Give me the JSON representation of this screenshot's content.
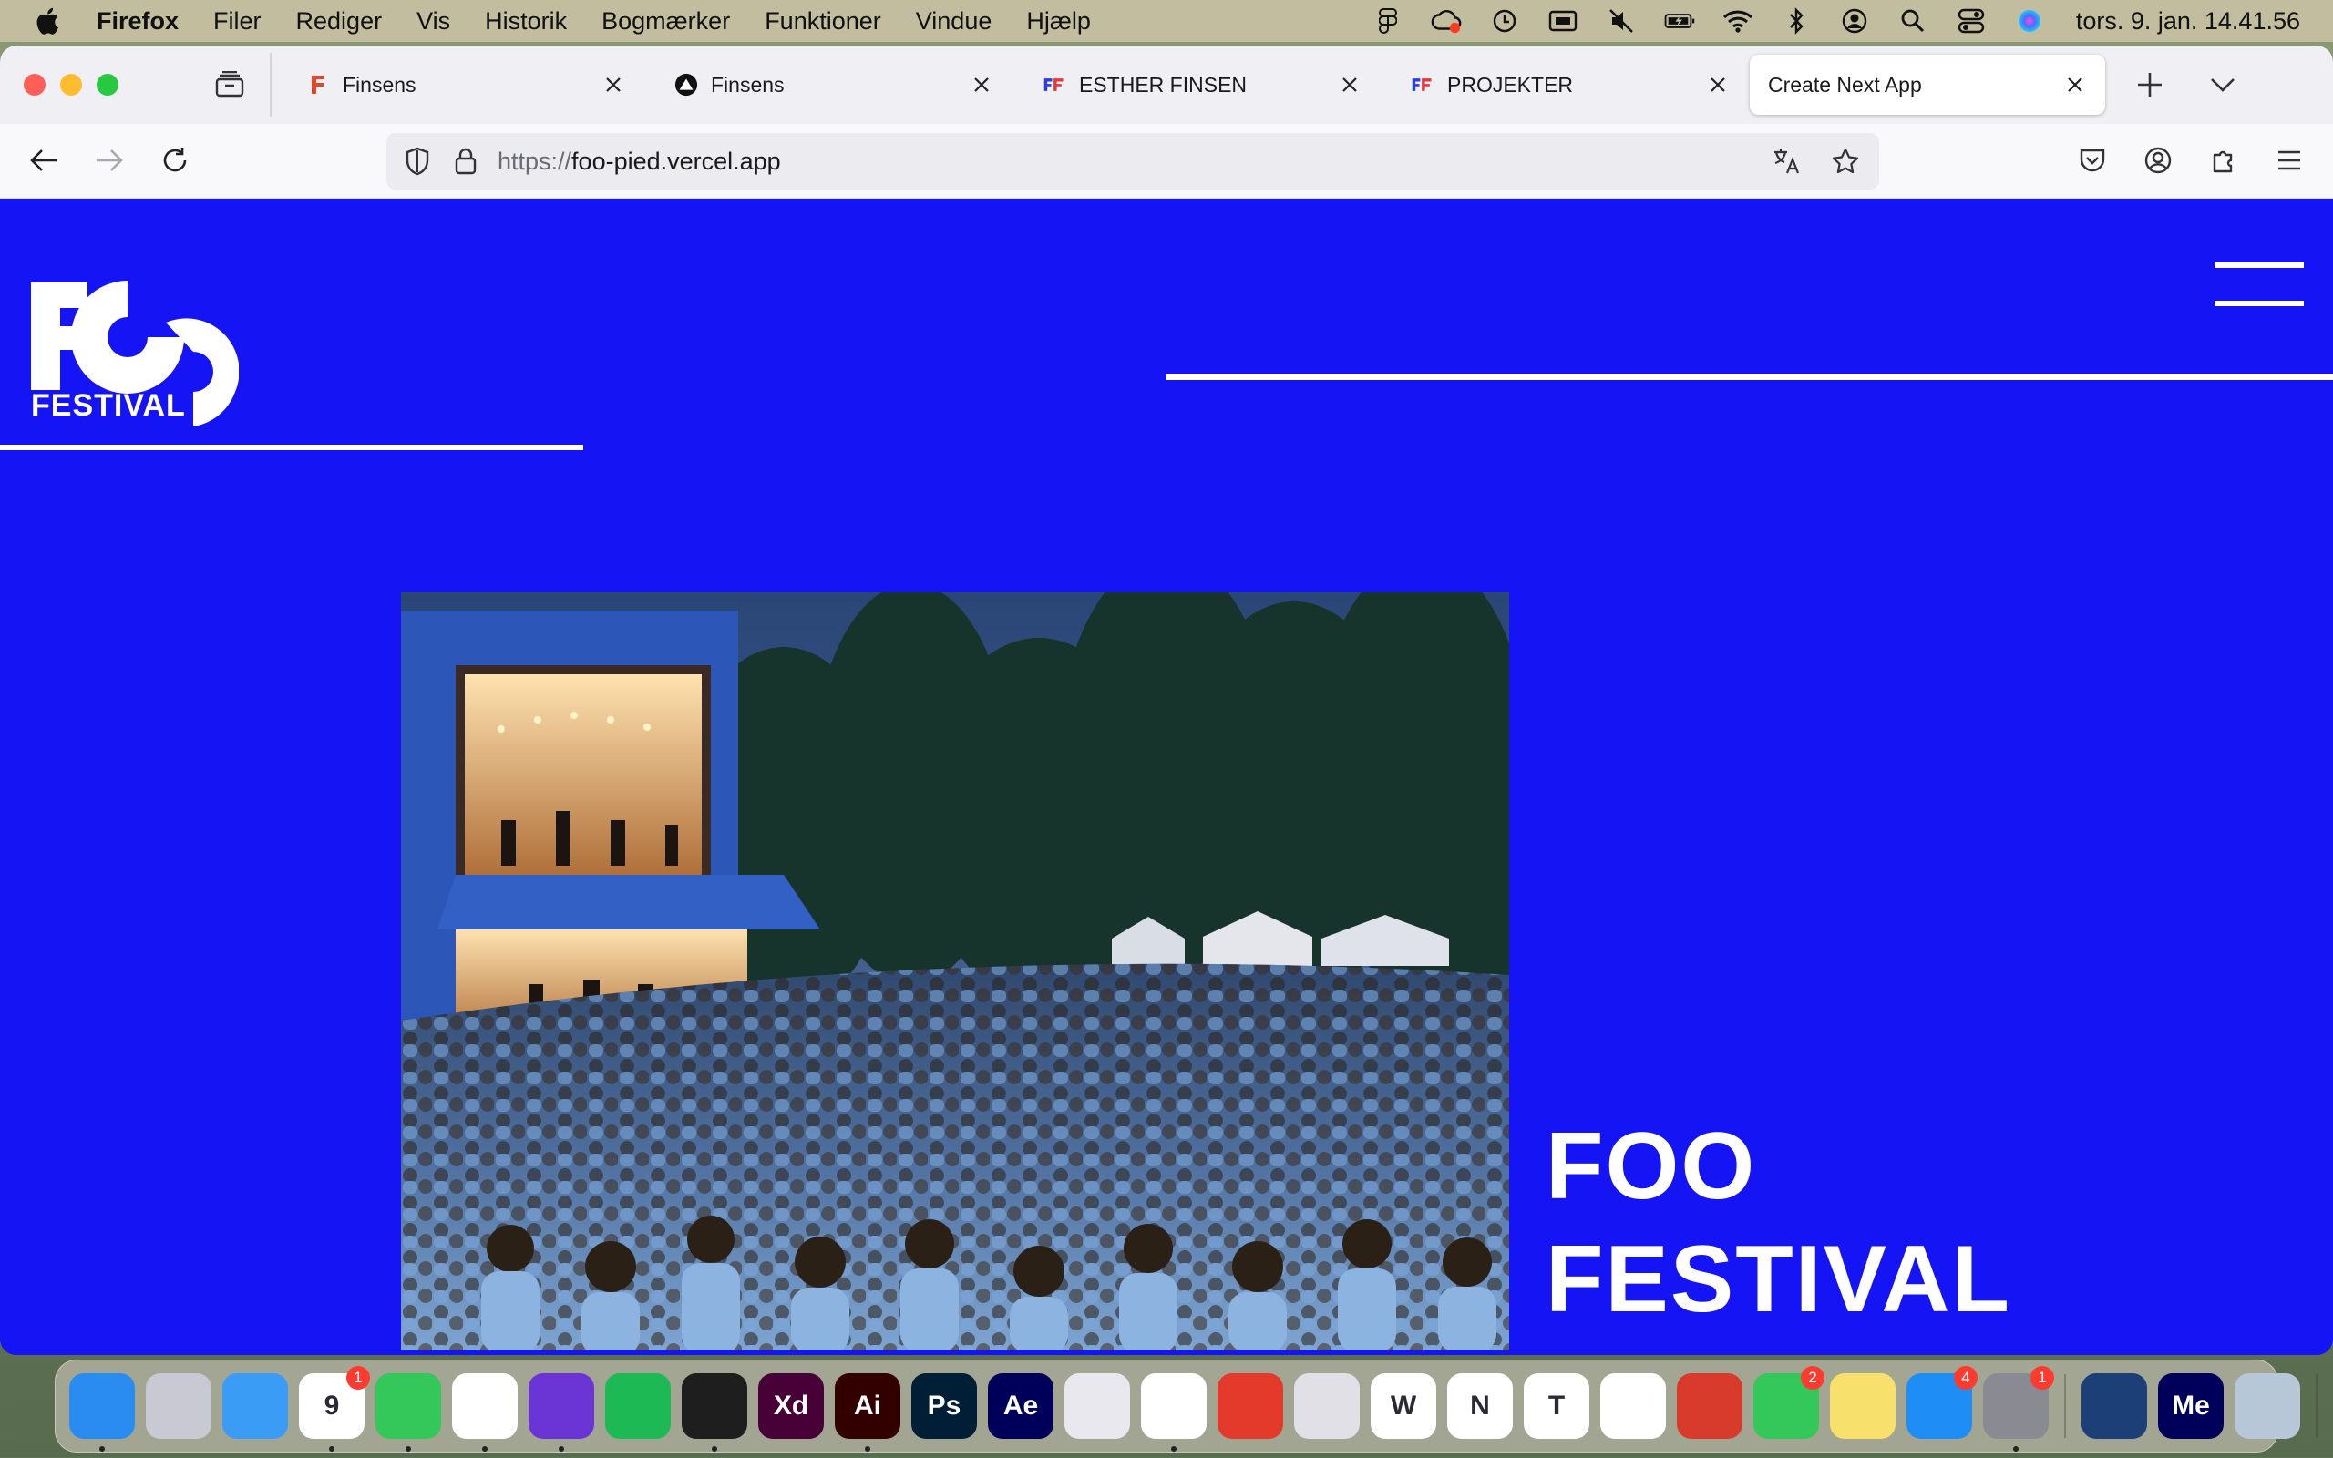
{
  "menubar": {
    "app_name": "Firefox",
    "menus": [
      "Filer",
      "Rediger",
      "Vis",
      "Historik",
      "Bogmærker",
      "Funktioner",
      "Vindue",
      "Hjælp"
    ],
    "clock": "tors. 9. jan.  14.41.56"
  },
  "tabs": [
    {
      "title": "Finsens",
      "favicon": "figma-f-icon"
    },
    {
      "title": "Finsens",
      "favicon": "vercel-icon"
    },
    {
      "title": "ESTHER FINSEN",
      "favicon": "ef-logo-icon"
    },
    {
      "title": "PROJEKTER",
      "favicon": "ef-logo-icon"
    },
    {
      "title": "Create Next App",
      "favicon": "none",
      "active": true
    }
  ],
  "urlbar": {
    "scheme": "https://",
    "host": "foo-pied.vercel.app"
  },
  "site": {
    "logo_text": "FESTIVAL",
    "hero_title_line1": "FOO",
    "hero_title_line2": "FESTIVAL",
    "background_color": "#1414f5",
    "image_description_name": "festival-crowd-photo"
  },
  "dock": {
    "apps": [
      {
        "name": "Finder",
        "label": "",
        "color": "#2a8cf0",
        "dot": true
      },
      {
        "name": "Launchpad",
        "label": "",
        "color": "#c9c9d4",
        "dot": false
      },
      {
        "name": "Mail",
        "label": "",
        "color": "#3b9cf5",
        "dot": false
      },
      {
        "name": "Calendar",
        "label": "9",
        "color": "#ffffff",
        "badge": "1",
        "dot": true
      },
      {
        "name": "Messages",
        "label": "",
        "color": "#34c759",
        "dot": true
      },
      {
        "name": "Chrome",
        "label": "",
        "color": "#ffffff",
        "dot": true
      },
      {
        "name": "Firefox",
        "label": "",
        "color": "#6b35d6",
        "dot": true
      },
      {
        "name": "Spotify",
        "label": "",
        "color": "#1db954",
        "dot": false
      },
      {
        "name": "Figma",
        "label": "",
        "color": "#1e1e1e",
        "dot": true
      },
      {
        "name": "Adobe XD",
        "label": "Xd",
        "color": "#470137",
        "dot": false
      },
      {
        "name": "Illustrator",
        "label": "Ai",
        "color": "#330000",
        "dot": true
      },
      {
        "name": "Photoshop",
        "label": "Ps",
        "color": "#001e36",
        "dot": false
      },
      {
        "name": "After Effects",
        "label": "Ae",
        "color": "#00005b",
        "dot": false
      },
      {
        "name": "Creative Cloud",
        "label": "",
        "color": "#e8e8ee",
        "dot": false
      },
      {
        "name": "VS Code",
        "label": "",
        "color": "#ffffff",
        "dot": true
      },
      {
        "name": "Safari",
        "label": "",
        "color": "#e33a2c",
        "dot": false
      },
      {
        "name": "Telegram",
        "label": "",
        "color": "#e0e0e6",
        "dot": false
      },
      {
        "name": "Word",
        "label": "W",
        "color": "#ffffff",
        "dot": false
      },
      {
        "name": "OneNote",
        "label": "N",
        "color": "#ffffff",
        "dot": false
      },
      {
        "name": "Teams",
        "label": "T",
        "color": "#ffffff",
        "dot": false
      },
      {
        "name": "Photos",
        "label": "",
        "color": "#ffffff",
        "dot": false
      },
      {
        "name": "Photo Booth",
        "label": "",
        "color": "#d83b2c",
        "dot": false
      },
      {
        "name": "FaceTime",
        "label": "",
        "color": "#34c759",
        "badge": "2",
        "dot": false
      },
      {
        "name": "Notes",
        "label": "",
        "color": "#f7e06b",
        "dot": false
      },
      {
        "name": "App Store",
        "label": "",
        "color": "#1e8df5",
        "badge": "4",
        "dot": false
      },
      {
        "name": "System Settings",
        "label": "",
        "color": "#8a8a92",
        "badge": "1",
        "dot": true
      },
      {
        "name": "QuickTime",
        "label": "",
        "color": "#1c3f77",
        "dot": false
      },
      {
        "name": "Media Encoder",
        "label": "Me",
        "color": "#00005b",
        "dot": false
      },
      {
        "name": "Preview",
        "label": "",
        "color": "#b7c7d8",
        "dot": false
      },
      {
        "name": "Trash",
        "label": "",
        "color": "#e4e4e8",
        "dot": false
      }
    ]
  }
}
